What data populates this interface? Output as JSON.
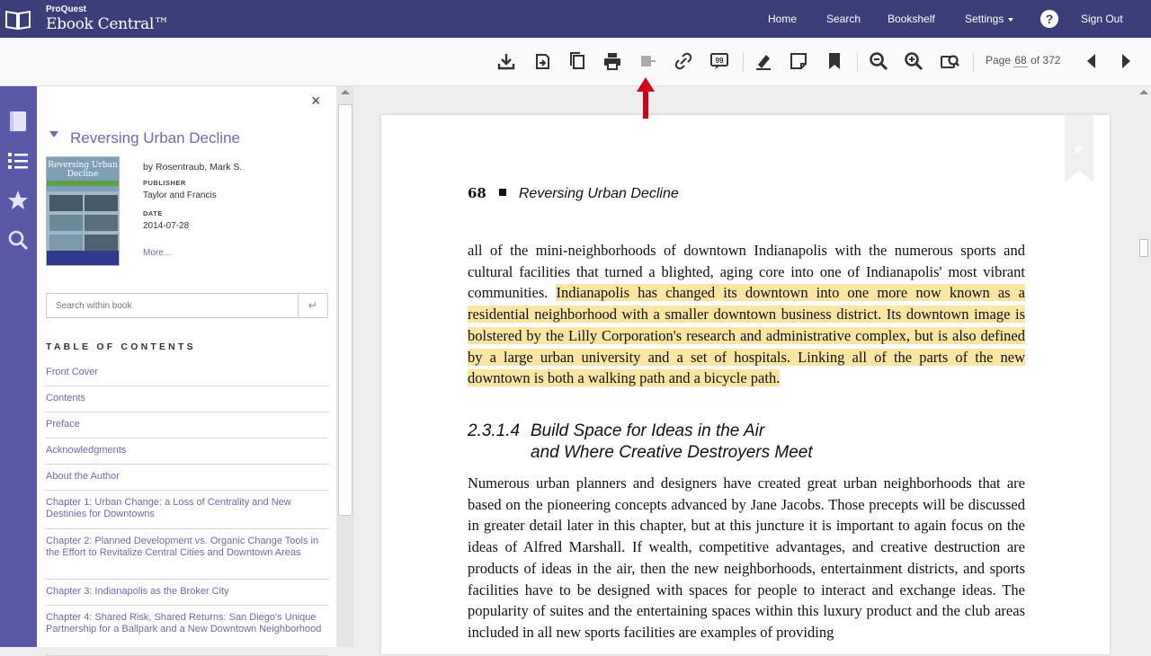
{
  "app": {
    "brand_small": "ProQuest",
    "brand_name": "Ebook Central™"
  },
  "nav": {
    "home": "Home",
    "search": "Search",
    "bookshelf": "Bookshelf",
    "settings": "Settings",
    "help": "?",
    "sign_out": "Sign Out"
  },
  "toolbar": {
    "page_prefix": "Page",
    "page_current": "68",
    "page_of": "of 372"
  },
  "panel": {
    "close": "×",
    "book_title": "Reversing Urban Decline",
    "cover_title": "Reversing Urban Decline",
    "author": "by Rosentraub, Mark S.",
    "publisher_label": "PUBLISHER",
    "publisher": "Taylor and Francis",
    "date_label": "DATE",
    "date": "2014-07-28",
    "more": "More...",
    "search_placeholder": "Search within book",
    "search_go": "↵",
    "toc_heading": "TABLE OF CONTENTS",
    "toc": [
      "Front Cover",
      "Contents",
      "Preface",
      "Acknowledgments",
      "About the Author",
      "Chapter 1: Urban Change: a Loss of Centrality and New Destinies for Downtowns",
      "Chapter 2: Planned Development vs. Organic Change Tools in the Effort to Revitalize Central Cities and Downtown Areas",
      "Chapter 3: Indianapolis as the Broker City",
      "Chapter 4: Shared Risk, Shared Returns: San Diego's Unique Partnership for a Ballpark and a New Downtown Neighborhood"
    ]
  },
  "page": {
    "number": "68",
    "running_title": "Reversing Urban Decline",
    "para1_plain": "all of the mini-neighborhoods of downtown Indianapolis with the numerous sports and cultural facilities that turned a blighted, aging core into one of Indianapolis' most vibrant communities. ",
    "para1_highlight": "Indianapolis has changed its downtown into one more now known as a residential neighborhood with a smaller downtown business district. Its downtown image is bolstered by the Lilly Corporation's research and administrative complex, but is also defined by a large urban university and a set of hospitals. Linking all of the parts of the new downtown is both a walking path and a bicycle path.",
    "subhead_num": "2.3.1.4",
    "subhead_line1": "Build Space for Ideas in the Air",
    "subhead_line2": "and Where Creative Destroyers Meet",
    "para2": "Numerous urban planners and designers have created great urban neighborhoods that are based on the pioneering concepts advanced by Jane Jacobs. Those precepts will be discussed in greater detail later in this chapter, but at this juncture it is important to again focus on the ideas of Alfred Marshall. If wealth, competitive advantages, and creative destruction are products of ideas in the air, then the new neighborhoods, entertainment districts, and sports facilities have to be designed with spaces for people to interact and exchange ideas. The popularity of suites and the entertaining spaces within this luxury product and the club areas included in all new sports facilities are examples of providing"
  },
  "colors": {
    "topbar": "#3a3f7a",
    "rail": "#5a59a8",
    "link": "#6a6ab0",
    "highlight": "#fbe5a2",
    "annotation_arrow": "#d0021b"
  },
  "icons": {
    "toolbar": [
      "download-icon",
      "cite-icon",
      "copy-icon",
      "print-icon",
      "share-disabled-icon",
      "link-icon",
      "citation-icon",
      "highlight-icon",
      "note-icon",
      "bookmark-icon",
      "zoom-out-icon",
      "zoom-in-icon",
      "fit-page-icon",
      "previous-page-icon",
      "next-page-icon"
    ],
    "rail": [
      "book-info-icon",
      "table-of-contents-icon",
      "favorites-star-icon",
      "search-icon"
    ]
  }
}
